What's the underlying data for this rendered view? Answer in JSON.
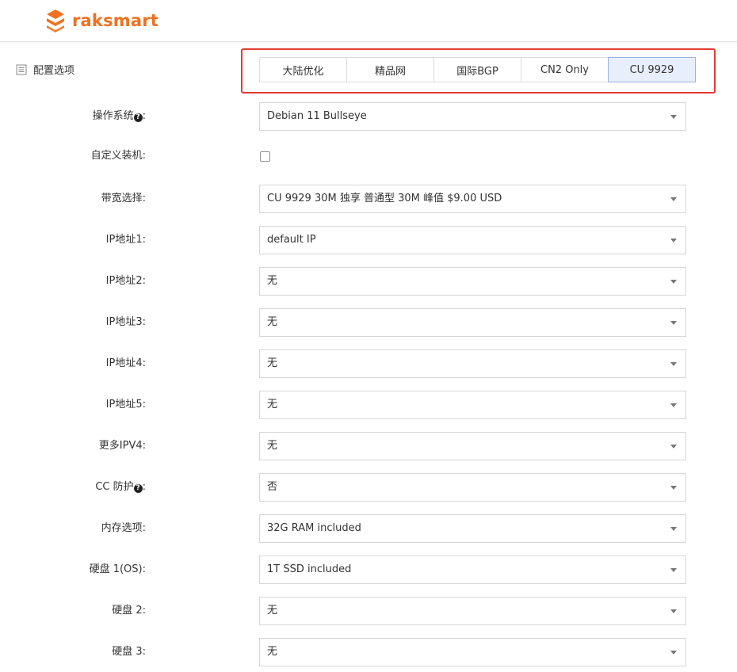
{
  "colors": {
    "brand": "#f0711f",
    "active_tab_bg": "#e8effc",
    "highlight_border": "#e53935"
  },
  "header": {
    "logo_icon": "raksmart-logo-icon",
    "logo_text": "raksmart"
  },
  "section": {
    "icon": "list-icon",
    "title": "配置选项"
  },
  "tabs": [
    {
      "label": "大陆优化",
      "active": false
    },
    {
      "label": "精品网",
      "active": false
    },
    {
      "label": "国际BGP",
      "active": false
    },
    {
      "label": "CN2 Only",
      "active": false
    },
    {
      "label": "CU 9929",
      "active": true
    }
  ],
  "form": {
    "os_label": "操作系统",
    "os_value": "Debian 11 Bullseye",
    "custom_install_label": "自定义装机:",
    "custom_install_checked": false,
    "bandwidth_label": "带宽选择:",
    "bandwidth_value": "CU 9929 30M 独享 普通型 30M 峰值 $9.00 USD",
    "ip1_label": "IP地址1:",
    "ip1_value": "default IP",
    "ip2_label": "IP地址2:",
    "ip2_value": "无",
    "ip3_label": "IP地址3:",
    "ip3_value": "无",
    "ip4_label": "IP地址4:",
    "ip4_value": "无",
    "ip5_label": "IP地址5:",
    "ip5_value": "无",
    "more_ipv4_label": "更多IPV4:",
    "more_ipv4_value": "无",
    "cc_label": "CC 防护",
    "cc_value": "否",
    "ram_label": "内存选项:",
    "ram_value": "32G RAM included",
    "disk1_label": "硬盘 1(OS):",
    "disk1_value": "1T SSD included",
    "disk2_label": "硬盘 2:",
    "disk2_value": "无",
    "disk3_label": "硬盘 3:",
    "disk3_value": "无",
    "help_glyph": "?",
    "label_colon": ":"
  }
}
